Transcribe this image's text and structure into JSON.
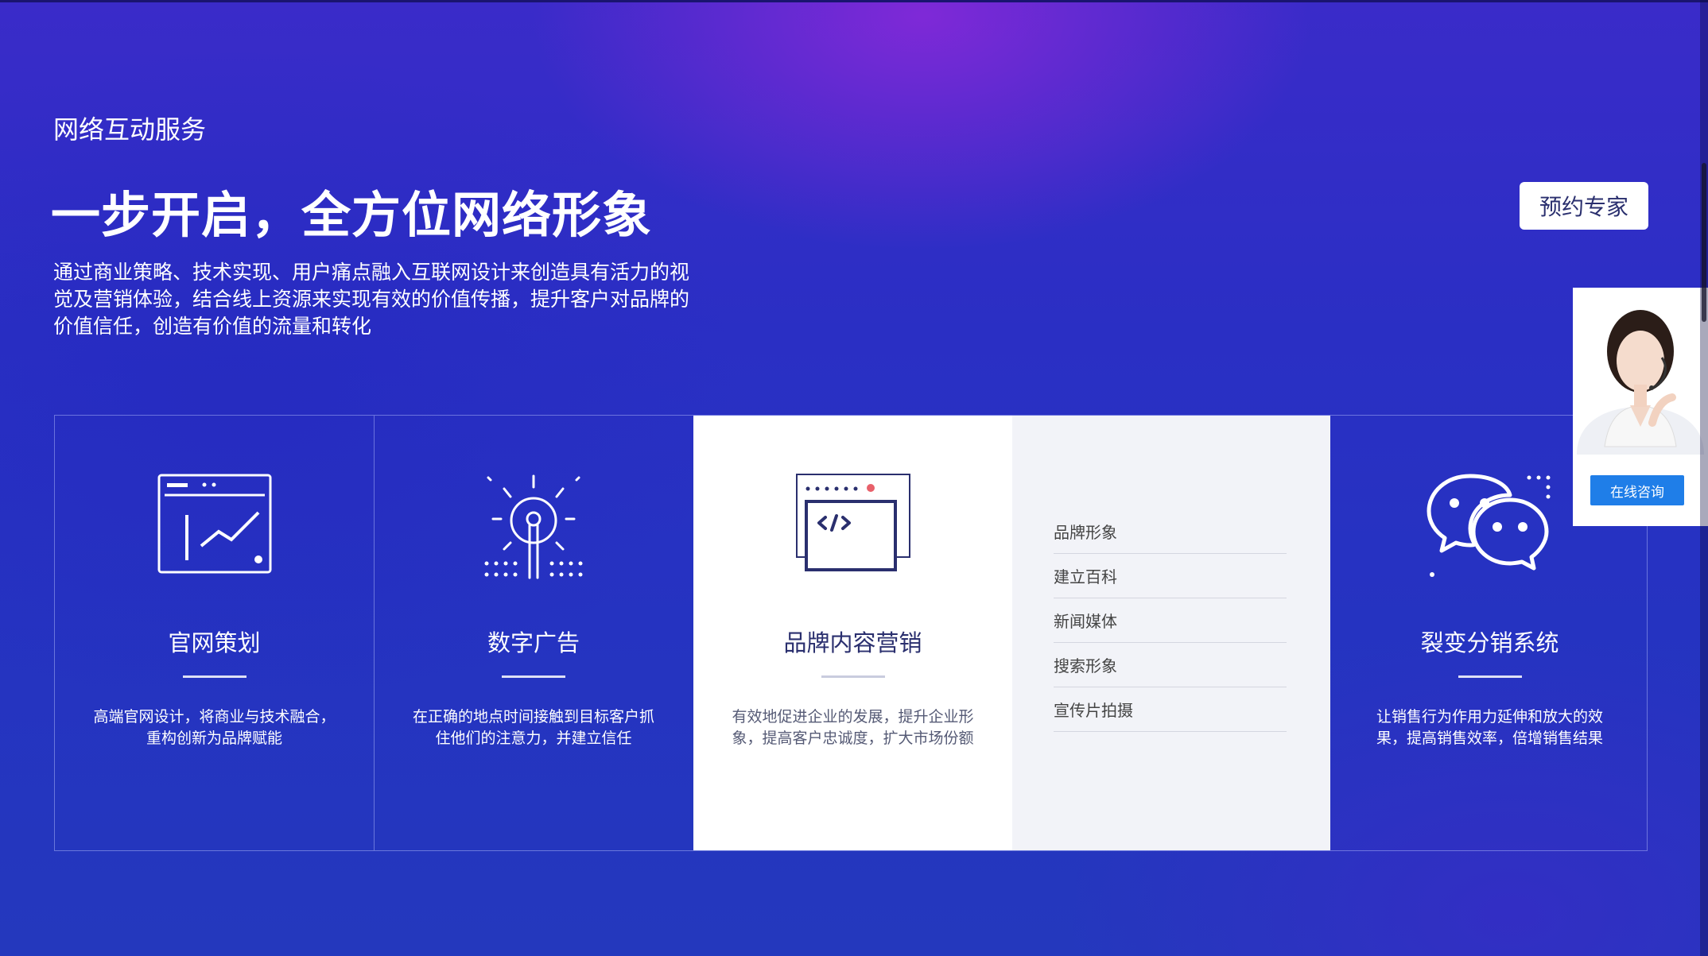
{
  "section": {
    "eyebrow": "网络互动服务",
    "headline": "一步开启，全方位网络形象",
    "intro": "通过商业策略、技术实现、用户痛点融入互联网设计来创造具有活力的视觉及营销体验，结合线上资源来实现有效的价值传播，提升客户对品牌的价值信任，创造有价值的流量和转化",
    "book_button": "预约专家"
  },
  "cards": [
    {
      "title": "官网策划",
      "desc": "高端官网设计，将商业与技术融合，重构创新为品牌赋能",
      "icon": "chart-window-icon"
    },
    {
      "title": "数字广告",
      "desc": "在正确的地点时间接触到目标客户抓住他们的注意力，并建立信任",
      "icon": "lightbulb-icon"
    },
    {
      "title": "品牌内容营销",
      "desc": "有效地促进企业的发展，提升企业形象，提高客户忠诚度，扩大市场份额",
      "icon": "code-window-icon"
    },
    {
      "title": "裂变分销系统",
      "desc": "让销售行为作用力延伸和放大的效果，提高销售效率，倍增销售结果",
      "icon": "wechat-icon"
    }
  ],
  "submenu": [
    "品牌形象",
    "建立百科",
    "新闻媒体",
    "搜索形象",
    "宣传片拍摄"
  ],
  "consult": {
    "button": "在线咨询"
  },
  "colors": {
    "accent": "#1f7ee8",
    "background": "#2a33c4",
    "text_dark": "#2a2f6e"
  }
}
